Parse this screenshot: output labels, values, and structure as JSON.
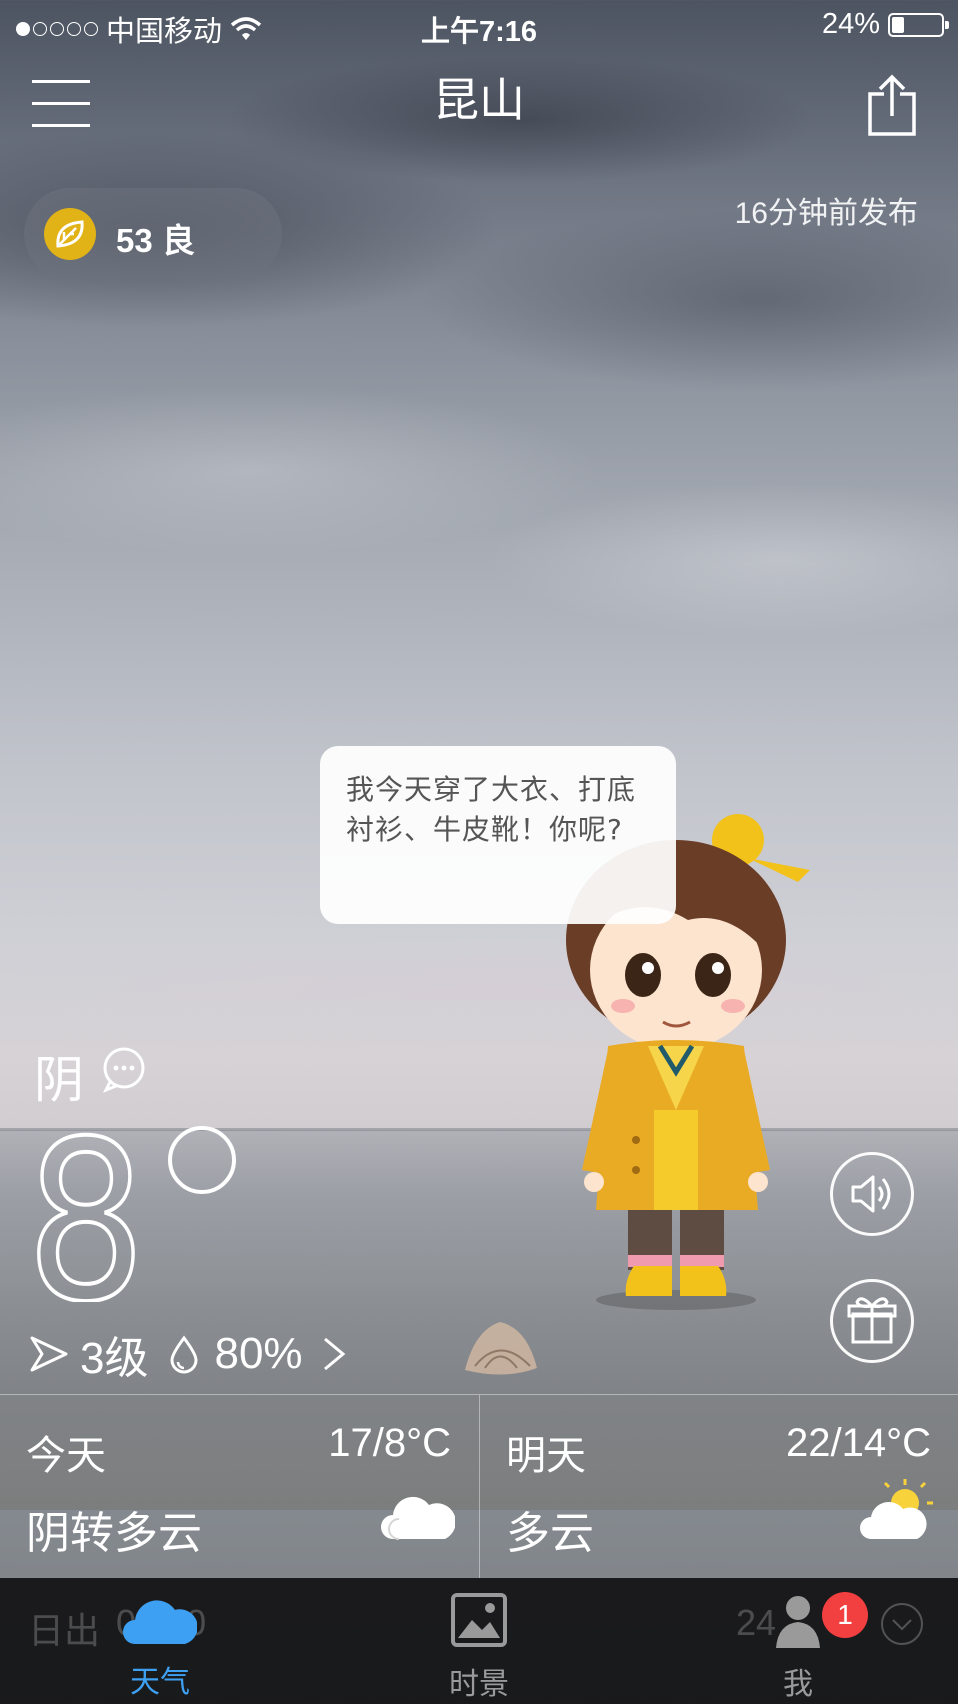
{
  "status_bar": {
    "carrier": "中国移动",
    "time": "上午7:16",
    "battery": "24%",
    "battery_level": 0.24,
    "signal_icon": "signal-dots-icon",
    "wifi_icon": "wifi-icon"
  },
  "header": {
    "city": "昆山",
    "menu_icon": "hamburger-menu-icon",
    "share_icon": "share-icon"
  },
  "air_quality": {
    "label": "53 良",
    "icon": "leaf-icon",
    "color": "#e1b317"
  },
  "published": "16分钟前发布",
  "speech_bubble": "我今天穿了大衣、打底衬衫、牛皮靴！你呢?",
  "current": {
    "condition": "阴",
    "temperature": "8",
    "degree_symbol": "°",
    "wind": "3级",
    "humidity": "80%"
  },
  "forecast": [
    {
      "day": "今天",
      "temp": "17/8°C",
      "condition": "阴转多云",
      "icon": "cloud-icon"
    },
    {
      "day": "明天",
      "temp": "22/14°C",
      "condition": "多云",
      "icon": "sun-cloud-icon"
    }
  ],
  "underlay": {
    "sunrise_label": "日出",
    "sunrise_value": "06:00",
    "right_value": "24"
  },
  "tabs": [
    {
      "label": "天气",
      "icon": "cloud-tab-icon",
      "active": true
    },
    {
      "label": "时景",
      "icon": "photo-tab-icon",
      "active": false
    },
    {
      "label": "我",
      "icon": "person-tab-icon",
      "active": false
    }
  ],
  "badge_count": "1",
  "colors": {
    "accent": "#3ea0f2",
    "badge": "#f23f3f",
    "aqi": "#e1b317"
  }
}
